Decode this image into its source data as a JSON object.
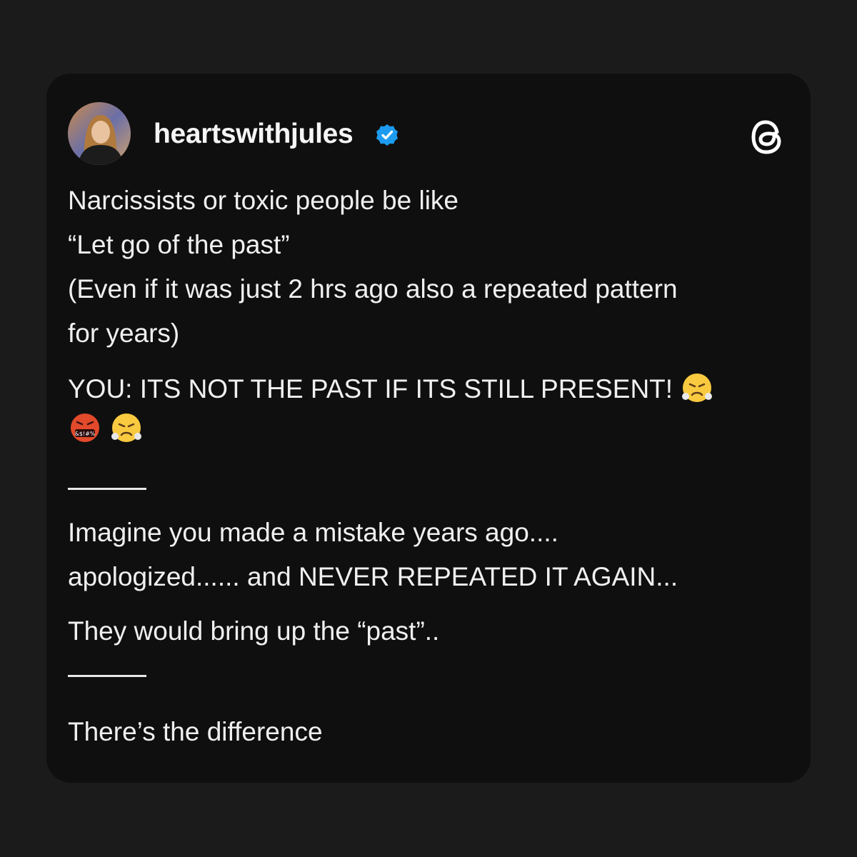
{
  "post": {
    "username": "heartswithjules",
    "verified_icon": "verified-badge-icon",
    "app_icon": "threads-logo-icon",
    "lines": [
      "Narcissists or toxic people be like",
      "“Let go of the past”",
      "(Even if it was just 2 hrs ago also a repeated pattern",
      "for years)"
    ],
    "shout_line": "YOU: ITS NOT THE PAST IF ITS STILL PRESENT!",
    "emoji_names": [
      "face-with-steam-icon",
      "face-with-symbols-icon",
      "face-with-steam-icon"
    ],
    "paragraph2_line1": "Imagine you made a mistake years ago....",
    "paragraph2_line2": "apologized...... and NEVER REPEATED IT AGAIN...",
    "paragraph3": "They would bring up the “past”..",
    "closing": "There’s the difference"
  },
  "colors": {
    "background": "#1b1b1b",
    "card": "#0f0f0f",
    "verified_blue": "#1d9bf0",
    "emoji_yellow": "#f9c940",
    "emoji_red": "#e24a2b"
  }
}
